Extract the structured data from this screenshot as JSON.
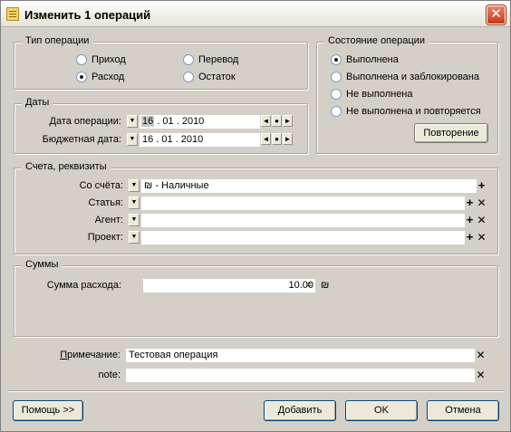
{
  "window": {
    "title": "Изменить 1 операций",
    "close_glyph": "✕"
  },
  "op_type": {
    "title": "Тип операции",
    "options": [
      "Приход",
      "Перевод",
      "Расход",
      "Остаток"
    ],
    "selected": "Расход"
  },
  "dates": {
    "title": "Даты",
    "op_date_label": "Дата операции:",
    "op_date_day": "16",
    "op_date_rest": ". 01 . 2010",
    "budget_date_label": "Бюджетная дата:",
    "budget_date_value": "16 . 01 . 2010"
  },
  "status": {
    "title": "Состояние операции",
    "options": [
      "Выполнена",
      "Выполнена и заблокирована",
      "Не выполнена",
      "Не выполнена и повторяется"
    ],
    "selected": "Выполнена",
    "repeat_button": "Повторение"
  },
  "accounts": {
    "title": "Счета, реквизиты",
    "from_label": "Со счёта:",
    "from_currency": "₪",
    "from_value": "- Наличные",
    "article_label": "Статья:",
    "agent_label": "Агент:",
    "project_label": "Проект:"
  },
  "sums": {
    "title": "Суммы",
    "expense_label": "Сумма расхода:",
    "expense_value": "10.00",
    "eq": "=",
    "currency": "₪"
  },
  "note": {
    "label": "Примечание:",
    "value": "Тестовая операция",
    "note2_label": "note:",
    "note2_value": ""
  },
  "buttons": {
    "help": "Помощь >>",
    "add": "Добавить",
    "ok": "OK",
    "cancel": "Отмена"
  },
  "icons": {
    "dropdown": "▼",
    "prev": "◄",
    "dot": "●",
    "next": "►",
    "plus": "+",
    "clear": "✕"
  }
}
